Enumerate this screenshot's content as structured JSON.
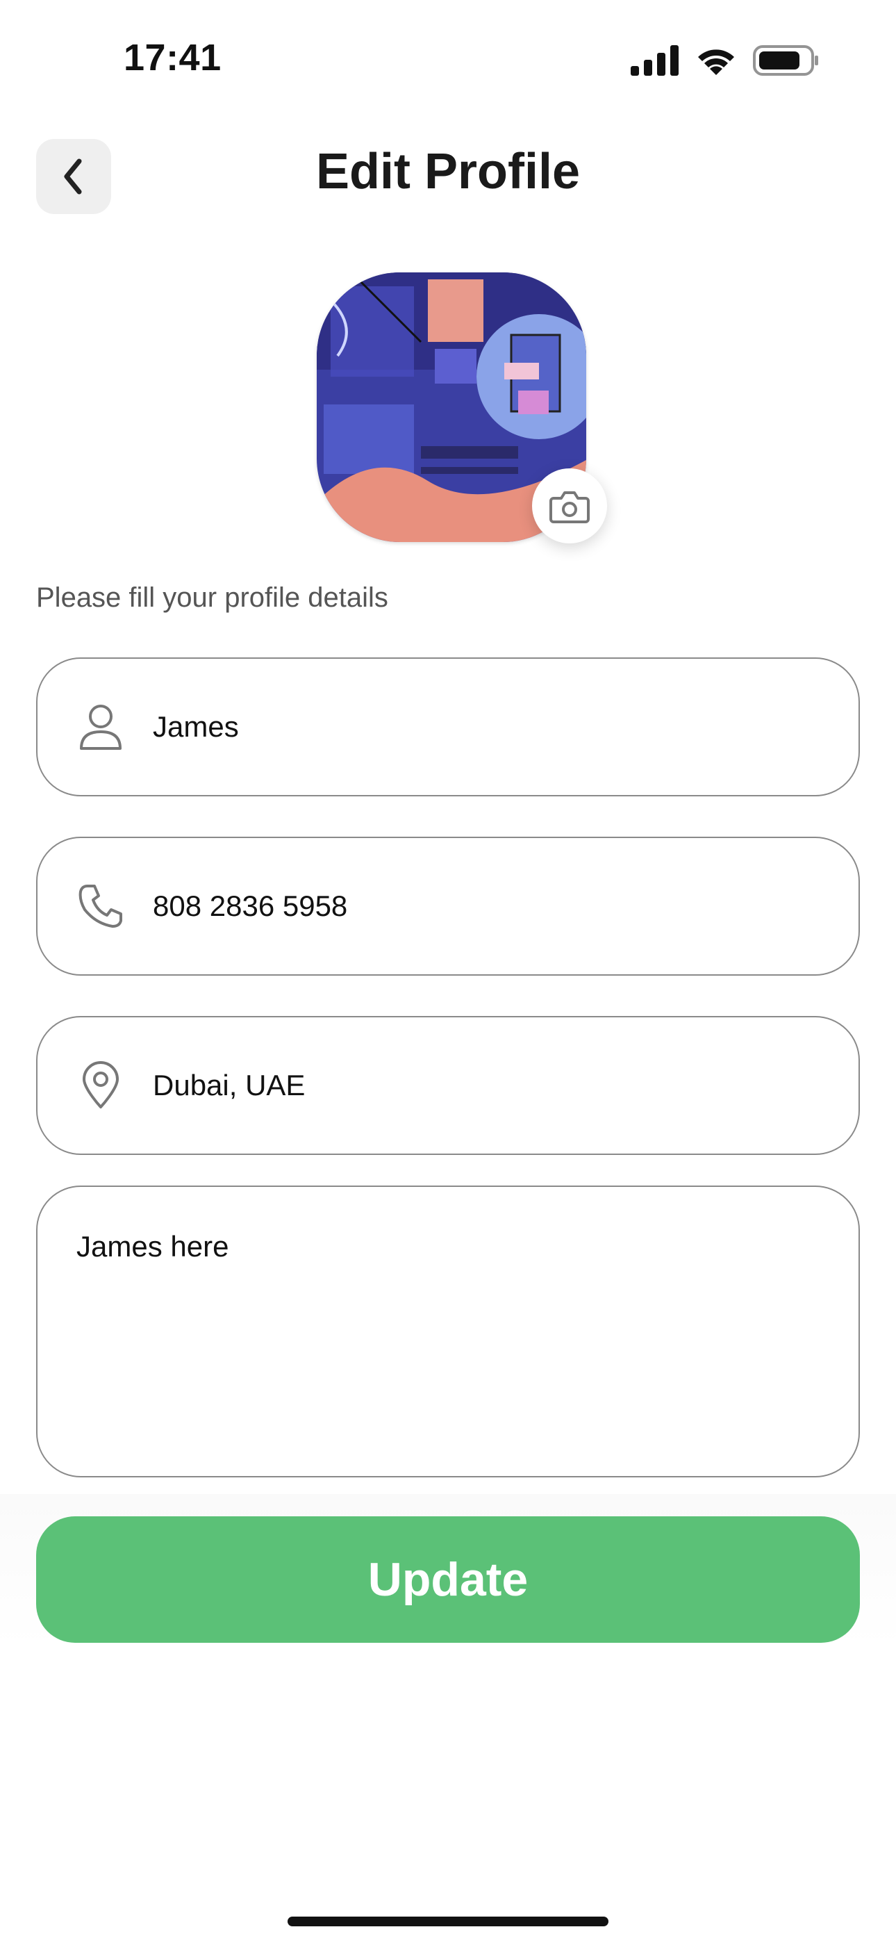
{
  "status_bar": {
    "time": "17:41",
    "icons": [
      "cellular-signal-icon",
      "wifi-icon",
      "battery-icon"
    ]
  },
  "header": {
    "title": "Edit Profile",
    "back_icon": "chevron-left-icon"
  },
  "avatar": {
    "edit_icon": "camera-icon"
  },
  "form": {
    "instruction": "Please fill your profile details",
    "name": {
      "icon": "person-icon",
      "value": "James"
    },
    "phone": {
      "icon": "phone-icon",
      "value": "808 2836 5958"
    },
    "location": {
      "icon": "location-pin-icon",
      "value": "Dubai, UAE"
    },
    "bio": {
      "value": "James here"
    }
  },
  "actions": {
    "update_label": "Update"
  },
  "colors": {
    "accent": "#5bc177",
    "field_border": "#8a8a8a",
    "back_button_bg": "#efefef"
  }
}
